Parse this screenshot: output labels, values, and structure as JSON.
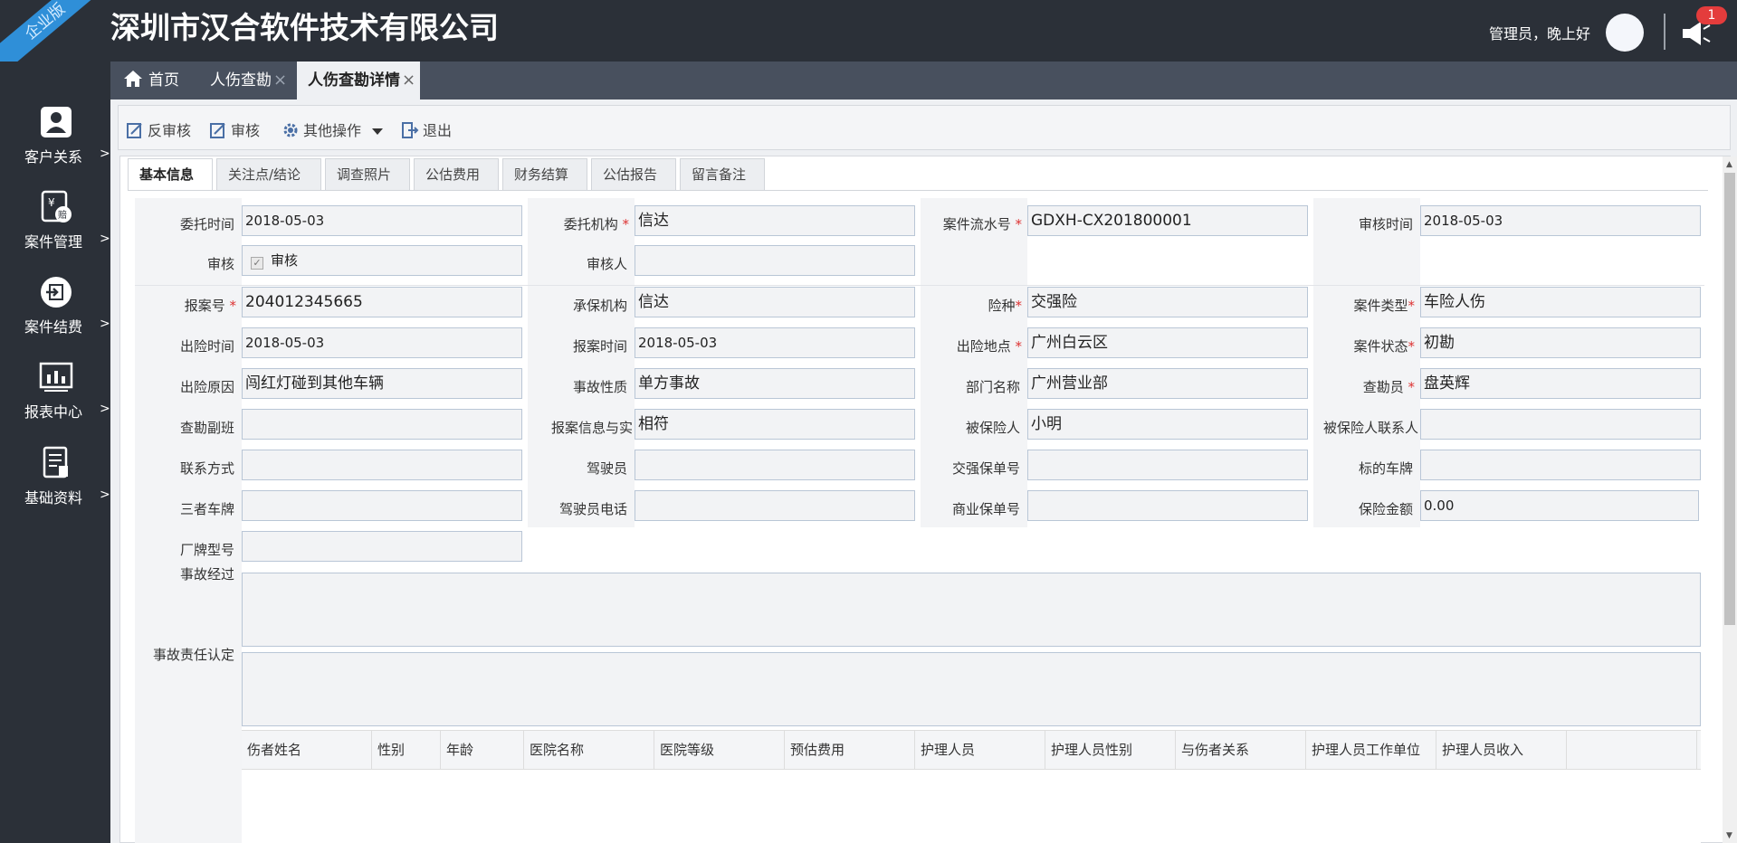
{
  "header": {
    "edition_ribbon": "企业版",
    "company": "深圳市汉合软件技术有限公司",
    "greeting": "管理员，晚上好",
    "notification_count": "1"
  },
  "sidebar": {
    "items": [
      {
        "label": "客户关系",
        "icon": "customer-icon"
      },
      {
        "label": "案件管理",
        "icon": "claim-icon"
      },
      {
        "label": "案件结费",
        "icon": "settle-icon"
      },
      {
        "label": "报表中心",
        "icon": "report-icon"
      },
      {
        "label": "基础资料",
        "icon": "document-icon"
      }
    ],
    "arrow": ">"
  },
  "tabs": [
    {
      "label": "首页",
      "icon": "home-icon"
    },
    {
      "label": "人伤查勘",
      "close": "×"
    },
    {
      "label": "人伤查勘详情",
      "close": "×"
    }
  ],
  "toolbar": {
    "unaudit": "反审核",
    "audit": "审核",
    "more": "其他操作",
    "exit": "退出"
  },
  "subtabs": [
    "基本信息",
    "关注点/结论",
    "调查照片",
    "公估费用",
    "财务结算",
    "公估报告",
    "留言备注"
  ],
  "form": {
    "labels": {
      "entrust_time": "委托时间",
      "entrust_org": "委托机构",
      "case_serial": "案件流水号",
      "audit_time": "审核时间",
      "audit": "审核",
      "auditor": "审核人",
      "report_no": "报案号",
      "insurer": "承保机构",
      "insurance_type": "险种",
      "case_type": "案件类型",
      "accident_time": "出险时间",
      "report_time": "报案时间",
      "accident_place": "出险地点",
      "case_status": "案件状态",
      "accident_cause": "出险原因",
      "accident_nature": "事故性质",
      "department": "部门名称",
      "surveyor": "查勘员",
      "survey_deputy": "查勘副班",
      "report_match": "报案信息与实",
      "insured": "被保险人",
      "insured_contact": "被保险人联系人",
      "contact": "联系方式",
      "driver": "驾驶员",
      "compulsory_policy": "交强保单号",
      "target_plate": "标的车牌",
      "third_plate": "三者车牌",
      "driver_phone": "驾驶员电话",
      "commercial_policy": "商业保单号",
      "insured_amount": "保险金额",
      "vehicle_model": "厂牌型号",
      "accident_process": "事故经过",
      "liability": "事故责任认定"
    },
    "required_mark": "*",
    "values": {
      "entrust_time": "2018-05-03",
      "entrust_org": "信达",
      "case_serial": "GDXH-CX201800001",
      "audit_time": "2018-05-03",
      "audit_checkbox": "审核",
      "auditor": "",
      "report_no": "204012345665",
      "insurer": "信达",
      "insurance_type": "交强险",
      "case_type": "车险人伤",
      "accident_time": "2018-05-03",
      "report_time": "2018-05-03",
      "accident_place": "广州白云区",
      "case_status": "初勘",
      "accident_cause": "闯红灯碰到其他车辆",
      "accident_nature": "单方事故",
      "department": "广州营业部",
      "surveyor": "盘英辉",
      "survey_deputy": "",
      "report_match": "相符",
      "insured": "小明",
      "insured_contact": "",
      "contact": "",
      "driver": "",
      "compulsory_policy": "",
      "target_plate": "",
      "third_plate": "",
      "driver_phone": "",
      "commercial_policy": "",
      "insured_amount": "0.00",
      "vehicle_model": ""
    }
  },
  "grid": {
    "columns": [
      "伤者姓名",
      "性别",
      "年龄",
      "医院名称",
      "医院等级",
      "预估费用",
      "护理人员",
      "护理人员性别",
      "与伤者关系",
      "护理人员工作单位",
      "护理人员收入"
    ]
  }
}
